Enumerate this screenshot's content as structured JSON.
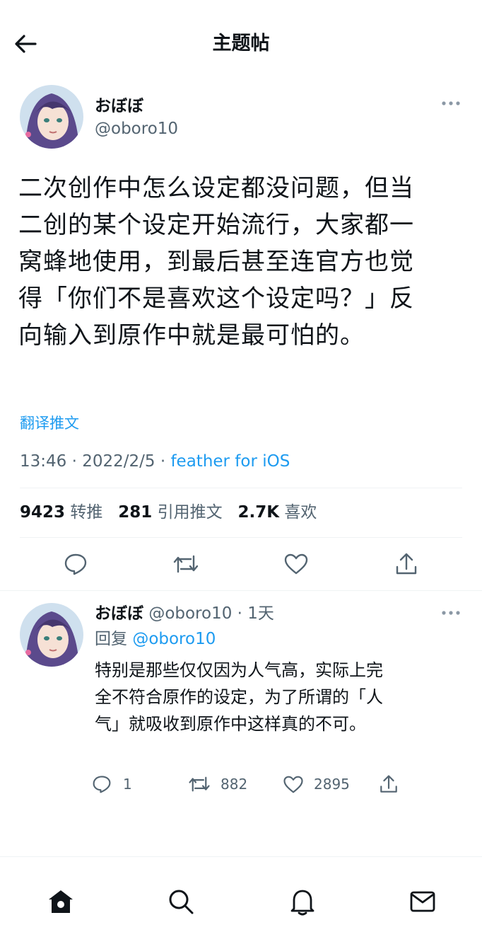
{
  "header": {
    "title": "主题帖"
  },
  "tweet": {
    "name": "おぼぼ",
    "handle": "@oboro10",
    "lines": [
      "二次创作中怎么设定都没问题，但当",
      "二创的某个设定开始流行，大家都一",
      "窝蜂地使用，到最后甚至连官方也觉",
      "得「你们不是喜欢这个设定吗？」反",
      "向输入到原作中就是最可怕的。"
    ],
    "translate": "翻译推文",
    "time": "13:46 · 2022/2/5 · ",
    "source": "feather for iOS",
    "stats": {
      "retweets": "9423",
      "retweets_label": "转推",
      "quotes": "281",
      "quotes_label": "引用推文",
      "likes": "2.7K",
      "likes_label": "喜欢"
    }
  },
  "reply": {
    "name": "おぼぼ",
    "handle": "@oboro10",
    "time": "1天",
    "reply_prefix": "回复",
    "reply_to": "@oboro10",
    "lines": [
      "特别是那些仅仅因为人气高，实际上完",
      "全不符合原作的设定，为了所谓的「人",
      "气」就吸收到原作中这样真的不可。"
    ],
    "counts": {
      "replies": "1",
      "retweets": "882",
      "likes": "2895"
    }
  },
  "colors": {
    "accent": "#1d9bf0",
    "text": "#0f1419",
    "muted": "#536471"
  },
  "nav": {
    "icons": [
      "home-icon",
      "search-icon",
      "notifications-icon",
      "messages-icon"
    ]
  }
}
